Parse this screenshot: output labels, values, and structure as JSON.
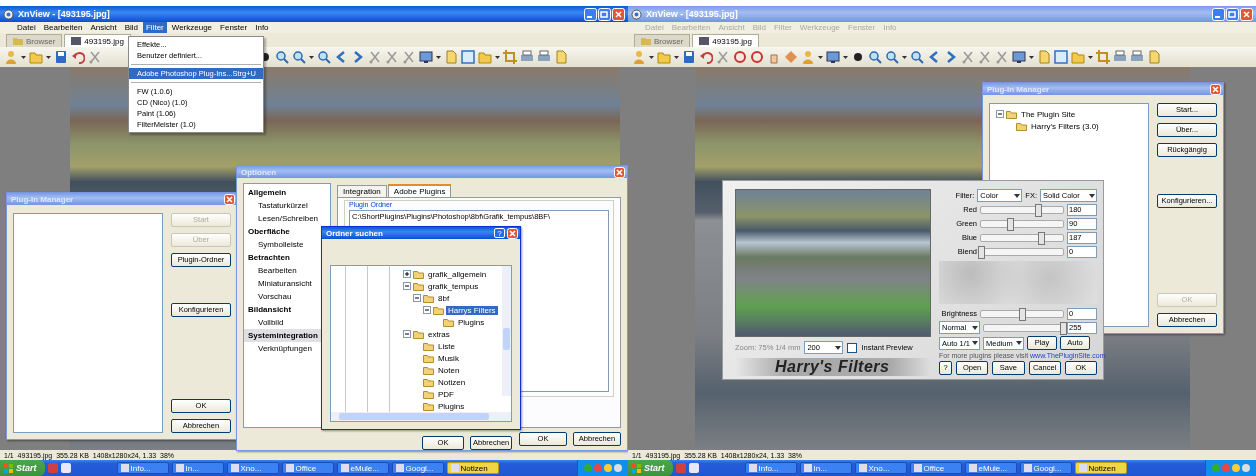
{
  "screens": [
    {
      "window": {
        "title": "XnView - [493195.jpg]",
        "active": true
      },
      "menu": [
        {
          "label": "Datei",
          "selected": false
        },
        {
          "label": "Bearbeiten",
          "selected": false
        },
        {
          "label": "Ansicht",
          "selected": false
        },
        {
          "label": "Bild",
          "selected": false
        },
        {
          "label": "Filter",
          "selected": true
        },
        {
          "label": "Werkzeuge",
          "selected": false
        },
        {
          "label": "Fenster",
          "selected": false
        },
        {
          "label": "Info",
          "selected": false
        }
      ],
      "tabs": [
        {
          "label": "Browser",
          "selected": false
        },
        {
          "label": "493195.jpg",
          "selected": true
        }
      ],
      "dropdown": {
        "items": [
          {
            "kind": "item",
            "label": "Effekte...",
            "selected": false
          },
          {
            "kind": "item",
            "label": "Benutzer definiert...",
            "selected": false
          },
          {
            "kind": "separator"
          },
          {
            "kind": "item",
            "label": "Adobe Photoshop Plug-Ins...",
            "shortcut": "Strg+U",
            "selected": true
          },
          {
            "kind": "separator"
          },
          {
            "kind": "item",
            "label": "FW (1.0.6)",
            "selected": false
          },
          {
            "kind": "item",
            "label": "CD (Nico) (1.0)",
            "selected": false
          },
          {
            "kind": "item",
            "label": "Paint (1.06)",
            "selected": false
          },
          {
            "kind": "item",
            "label": "FilterMeister (1.0)",
            "selected": false
          }
        ]
      },
      "dialogs": [
        {
          "kind": "plugin_manager",
          "title": "Plug-In Manager",
          "active": false,
          "buttons_top": [
            {
              "label": "Start",
              "disabled": true
            },
            {
              "label": "Über",
              "disabled": true
            },
            {
              "label": "Plugin-Ordner",
              "disabled": false
            }
          ],
          "buttons_middle": [
            {
              "label": "Konfigurieren",
              "disabled": false
            }
          ],
          "buttons_bottom": [
            {
              "label": "OK",
              "disabled": false
            },
            {
              "label": "Abbrechen",
              "disabled": false
            }
          ]
        },
        {
          "kind": "options",
          "title": "Optionen",
          "active": false,
          "categories": [
            {
              "kind": "heading",
              "label": "Allgemein",
              "selected": false
            },
            {
              "kind": "page",
              "label": "Tastaturkürzel",
              "selected": false
            },
            {
              "kind": "page",
              "label": "Lesen/Schreiben",
              "selected": false
            },
            {
              "kind": "heading",
              "label": "Oberfläche",
              "selected": false
            },
            {
              "kind": "page",
              "label": "Symbolleiste",
              "selected": false
            },
            {
              "kind": "heading",
              "label": "Betrachten",
              "selected": false
            },
            {
              "kind": "page",
              "label": "Bearbeiten",
              "selected": false
            },
            {
              "kind": "page",
              "label": "Miniaturansicht",
              "selected": false
            },
            {
              "kind": "page",
              "label": "Vorschau",
              "selected": false
            },
            {
              "kind": "heading",
              "label": "Bildansicht",
              "selected": false
            },
            {
              "kind": "page",
              "label": "Vollbild",
              "selected": false
            },
            {
              "kind": "heading",
              "label": "Systemintegration",
              "selected": true
            },
            {
              "kind": "page",
              "label": "Verknüpfungen",
              "selected": false
            }
          ],
          "tabs": [
            {
              "label": "Integration",
              "selected": false
            },
            {
              "label": "Adobe Plugins",
              "selected": true
            }
          ],
          "group_label": "Plugin Ordner",
          "path": "C:\\ShortPlugins\\Plugins\\Photoshop\\8bf\\Grafik_tempus\\8BF\\",
          "buttons": [
            {
              "label": "OK",
              "disabled": false
            },
            {
              "label": "Abbrechen",
              "disabled": false
            }
          ]
        },
        {
          "kind": "folder_browser",
          "title": "Ordner suchen",
          "active": true,
          "help_button": "?",
          "tree": [
            {
              "label": "grafik_allgemein",
              "expanded": false,
              "selected": false
            },
            {
              "label": "grafik_tempus",
              "expanded": true,
              "selected": false,
              "children": [
                {
                  "label": "8bf",
                  "expanded": true,
                  "selected": false,
                  "children": [
                    {
                      "label": "Harrys Filters",
                      "expanded": true,
                      "selected": true,
                      "children": [
                        {
                          "label": "Plugins",
                          "selected": false
                        }
                      ]
                    }
                  ]
                }
              ]
            },
            {
              "label": "extras",
              "expanded": true,
              "selected": false,
              "children": [
                {
                  "label": "Liste",
                  "selected": false
                },
                {
                  "label": "Musik",
                  "selected": false
                },
                {
                  "label": "Noten",
                  "selected": false
                },
                {
                  "label": "Notizen",
                  "selected": false
                },
                {
                  "label": "PDF",
                  "selected": false
                },
                {
                  "label": "Plugins",
                  "selected": false
                }
              ]
            }
          ],
          "buttons": [
            {
              "label": "OK",
              "disabled": false
            },
            {
              "label": "Abbrechen",
              "disabled": false
            }
          ]
        }
      ],
      "status_bar": "1/1  493195.jpg  355.28 KB  1408x1280x24, 1.33  38%",
      "taskbar": {
        "start": "Start",
        "tasks": [
          {
            "label": "Info...",
            "selected": false
          },
          {
            "label": "In...",
            "selected": false
          },
          {
            "label": "Xno...",
            "selected": false
          },
          {
            "label": "Office",
            "selected": false
          },
          {
            "label": "eMule...",
            "selected": false
          },
          {
            "label": "Googl...",
            "selected": false
          },
          {
            "label": "Notizen",
            "selected": true
          }
        ]
      }
    },
    {
      "window": {
        "title": "XnView - [493195.jpg]",
        "active": false
      },
      "menu": [
        {
          "label": "Datei",
          "selected": false
        },
        {
          "label": "Bearbeiten",
          "selected": false
        },
        {
          "label": "Ansicht",
          "selected": false
        },
        {
          "label": "Bild",
          "selected": false
        },
        {
          "label": "Filter",
          "selected": false
        },
        {
          "label": "Werkzeuge",
          "selected": false
        },
        {
          "label": "Fenster",
          "selected": false
        },
        {
          "label": "Info",
          "selected": false
        }
      ],
      "tabs": [
        {
          "label": "Browser",
          "selected": false
        },
        {
          "label": "493195.jpg",
          "selected": true
        }
      ],
      "dialogs": [
        {
          "kind": "plugin_manager",
          "title": "Plug-In Manager",
          "active": false,
          "tree": [
            {
              "label": "The Plugin Site",
              "expanded": true,
              "selected": false,
              "children": [
                {
                  "label": "Harry's Filters (3.0)",
                  "selected": false
                }
              ]
            }
          ],
          "buttons_top": [
            {
              "label": "Start...",
              "disabled": false
            },
            {
              "label": "Über...",
              "disabled": false
            },
            {
              "label": "Rückgängig",
              "disabled": false
            }
          ],
          "buttons_middle": [
            {
              "label": "Konfigurieren...",
              "disabled": false
            }
          ],
          "buttons_bottom": [
            {
              "label": "OK",
              "disabled": true
            },
            {
              "label": "Abbrechen",
              "disabled": false
            }
          ]
        },
        {
          "kind": "harrys_filters",
          "filter": {
            "label": "Filter:",
            "value": "Color"
          },
          "fx": {
            "label": "FX:",
            "value": "Solid Color"
          },
          "sliders": [
            {
              "label": "Red",
              "value": "180",
              "level": 0.7
            },
            {
              "label": "Green",
              "value": "90",
              "level": 0.35
            },
            {
              "label": "Blue",
              "value": "187",
              "level": 0.73
            },
            {
              "label": "Blend",
              "value": "0",
              "level": 0
            }
          ],
          "brightness": {
            "label": "Brightness",
            "value": "0",
            "level": 0.5
          },
          "mode": {
            "value": "Normal",
            "amount": "255",
            "level": 1
          },
          "preview_size": "Auto 1/1",
          "quality": "Medium",
          "play_button": "Play",
          "auto_button": "Auto",
          "zoom_info": "Zoom: 75% 1/4 mm",
          "zoom": "200",
          "instant_preview": {
            "label": "Instant Preview",
            "checked": false
          },
          "info_text": "For more plugins please visit ",
          "link": "www.ThePluginSite.com",
          "logo": "Harry's Filters",
          "buttons": [
            "?",
            "Open",
            "Save",
            "Cancel",
            "OK"
          ]
        }
      ],
      "status_bar": "1/1  493195.jpg  355.28 KB  1408x1280x24, 1.33  38%",
      "taskbar": {
        "start": "Start",
        "tasks": [
          {
            "label": "Info...",
            "selected": false
          },
          {
            "label": "In...",
            "selected": false
          },
          {
            "label": "Xno...",
            "selected": false
          },
          {
            "label": "Office",
            "selected": false
          },
          {
            "label": "eMule...",
            "selected": false
          },
          {
            "label": "Googl...",
            "selected": false
          },
          {
            "label": "Notizen",
            "selected": true
          }
        ]
      }
    }
  ]
}
